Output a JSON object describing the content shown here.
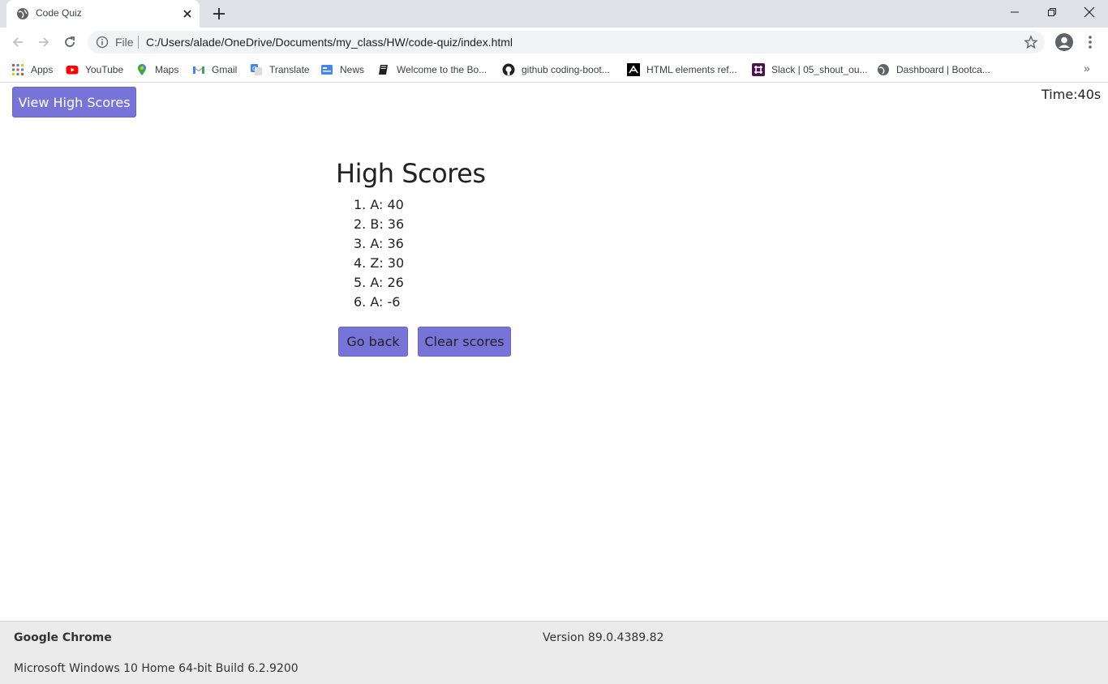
{
  "browser": {
    "tab_title": "Code Quiz",
    "omnibox_scheme": "File",
    "url": "C:/Users/alade/OneDrive/Documents/my_class/HW/code-quiz/index.html",
    "bookmarks": [
      {
        "label": "Apps",
        "icon": "apps-grid-icon"
      },
      {
        "label": "YouTube",
        "icon": "youtube-icon"
      },
      {
        "label": "Maps",
        "icon": "maps-pin-icon"
      },
      {
        "label": "Gmail",
        "icon": "gmail-icon"
      },
      {
        "label": "Translate",
        "icon": "translate-icon"
      },
      {
        "label": "News",
        "icon": "news-icon"
      },
      {
        "label": "Welcome to the Bo...",
        "icon": "book-icon"
      },
      {
        "label": "github coding-boot...",
        "icon": "github-icon"
      },
      {
        "label": "HTML elements ref...",
        "icon": "mdn-icon"
      },
      {
        "label": "Slack | 05_shout_ou...",
        "icon": "slack-icon"
      },
      {
        "label": "Dashboard | Bootca...",
        "icon": "globe-icon"
      }
    ],
    "more_bookmarks": "»"
  },
  "page": {
    "view_high_scores": "View High Scores",
    "timer": "Time:40s",
    "title": "High Scores",
    "scores": [
      "1. A: 40",
      "2. B: 36",
      "3. A: 36",
      "4. Z: 30",
      "5. A: 26",
      "6. A: -6"
    ],
    "go_back": "Go back",
    "clear_scores": "Clear scores",
    "accent_color": "#7873d9"
  },
  "infobar": {
    "app_name": "Google Chrome",
    "version": "Version 89.0.4389.82",
    "os": "Microsoft Windows 10 Home 64-bit Build 6.2.9200"
  }
}
